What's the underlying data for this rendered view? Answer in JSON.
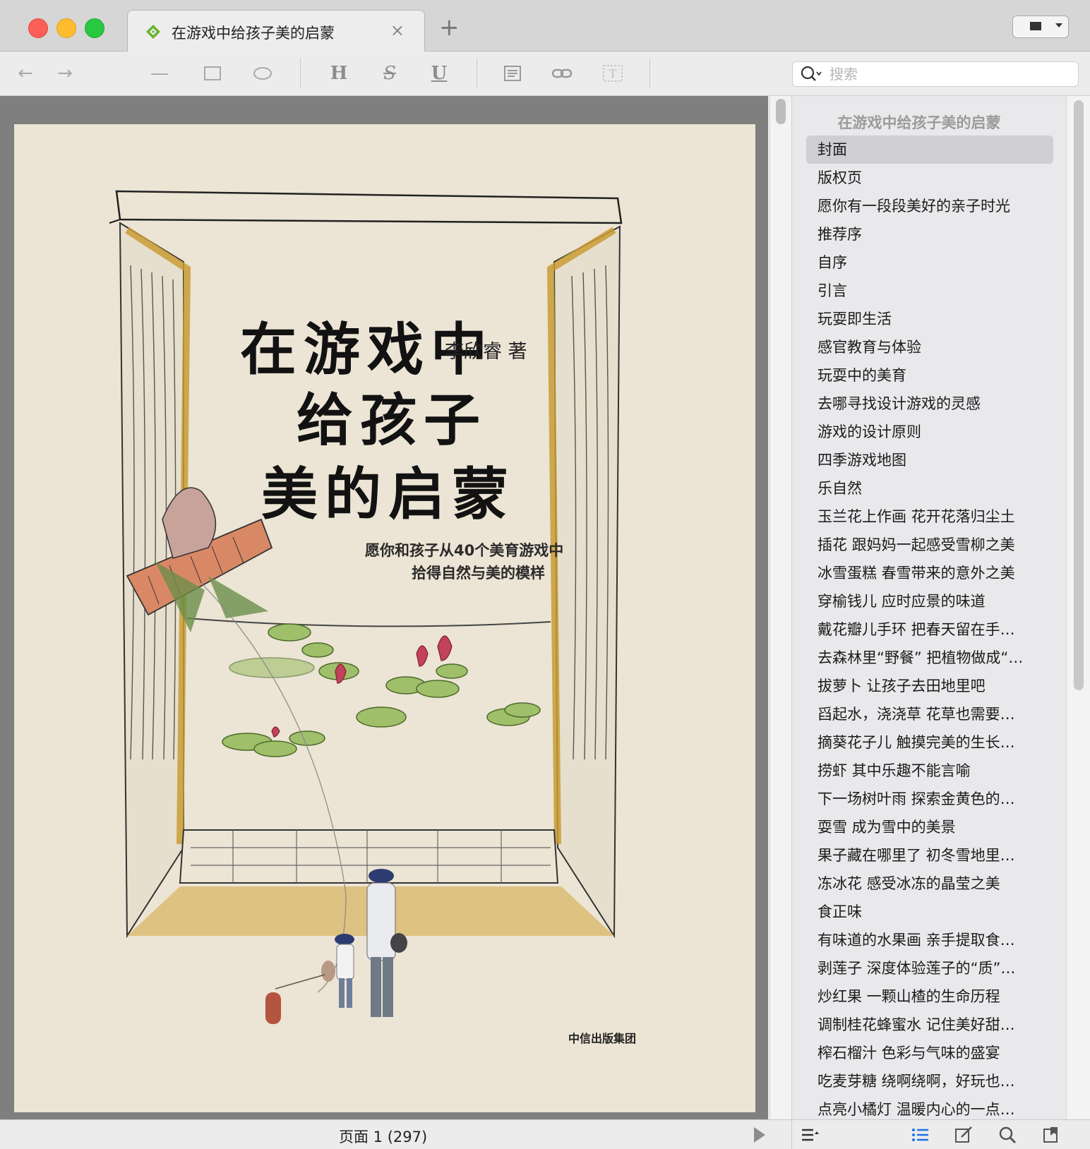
{
  "window": {
    "tab_title": "在游戏中给孩子美的启蒙",
    "close_glyph": "×",
    "new_tab_glyph": "+"
  },
  "toolbar": {
    "back_glyph": "←",
    "forward_glyph": "→",
    "line_glyph": "—",
    "heading_glyph": "H",
    "strike_glyph": "S",
    "underline_glyph": "U",
    "icons": [
      "back-arrow-icon",
      "forward-arrow-icon",
      "line-tool-icon",
      "rectangle-tool-icon",
      "ellipse-tool-icon",
      "heading-icon",
      "strikethrough-icon",
      "underline-icon",
      "note-icon",
      "link-icon",
      "text-box-icon"
    ]
  },
  "search": {
    "placeholder": "搜索"
  },
  "cover": {
    "title_line1": "在游戏中",
    "title_line2": "给孩子",
    "title_line3": "美的启蒙",
    "author": "李欣睿 著",
    "subtitle_line1": "愿你和孩子从40个美育游戏中",
    "subtitle_line2": "拾得自然与美的模样",
    "publisher": "中信出版集团"
  },
  "toc": {
    "title": "在游戏中给孩子美的启蒙",
    "selected_index": 0,
    "items": [
      "封面",
      "版权页",
      "愿你有一段段美好的亲子时光",
      "推荐序",
      "自序",
      "引言",
      "玩耍即生活",
      "感官教育与体验",
      "玩耍中的美育",
      "去哪寻找设计游戏的灵感",
      "游戏的设计原则",
      "四季游戏地图",
      "乐自然",
      "玉兰花上作画 花开花落归尘土",
      "插花 跟妈妈一起感受雪柳之美",
      "冰雪蛋糕 春雪带来的意外之美",
      "穿榆钱儿 应时应景的味道",
      "戴花瓣儿手环 把春天留在手…",
      "去森林里“野餐” 把植物做成“…",
      "拔萝卜 让孩子去田地里吧",
      "舀起水，浇浇草 花草也需要…",
      "摘葵花子儿 触摸完美的生长…",
      "捞虾 其中乐趣不能言喻",
      "下一场树叶雨 探索金黄色的…",
      "耍雪 成为雪中的美景",
      "果子藏在哪里了 初冬雪地里…",
      "冻冰花 感受冰冻的晶莹之美",
      "食正味",
      "有味道的水果画 亲手提取食…",
      "剥莲子 深度体验莲子的“质”…",
      "炒红果 一颗山楂的生命历程",
      "调制桂花蜂蜜水 记住美好甜…",
      "榨石榴汁 色彩与气味的盛宴",
      "吃麦芽糖 绕啊绕啊，好玩也…",
      "点亮小橘灯 温暖内心的一点…"
    ]
  },
  "status": {
    "page_label": "页面 1 (297)",
    "icons": [
      "play-icon",
      "outline-menu-icon",
      "toc-list-icon",
      "edit-note-icon",
      "search-icon",
      "bookmark-icon"
    ]
  },
  "colors": {
    "close": "#fc5f57",
    "minimize": "#fdbc2e",
    "maximize": "#28c840",
    "accent": "#1a73e8",
    "page_bg": "#ece4d4"
  }
}
